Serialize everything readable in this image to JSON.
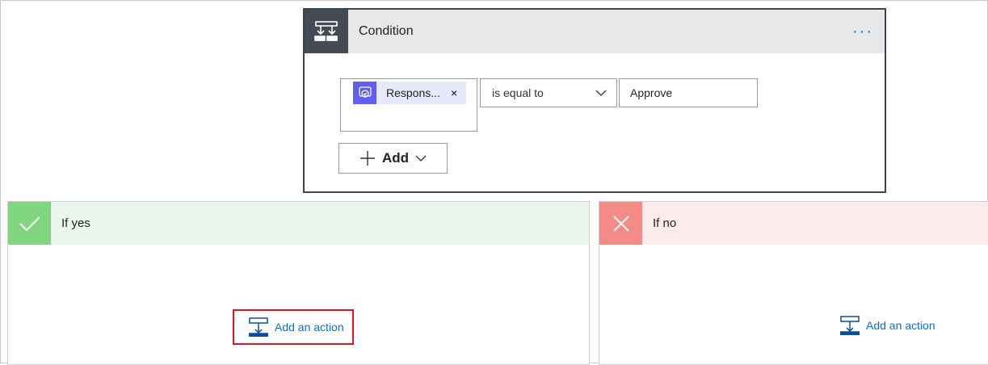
{
  "condition": {
    "title": "Condition",
    "menu": "···",
    "token": "Respons...",
    "token_remove": "×",
    "operator": "is equal to",
    "value": "Approve",
    "add_label": "Add"
  },
  "yes": {
    "title": "If yes",
    "action": "Add an action",
    "color": "#7fd67f",
    "bg": "#eaf6ec"
  },
  "no": {
    "title": "If no",
    "action": "Add an action",
    "color": "#f58b86",
    "bg": "#fdeaea"
  }
}
